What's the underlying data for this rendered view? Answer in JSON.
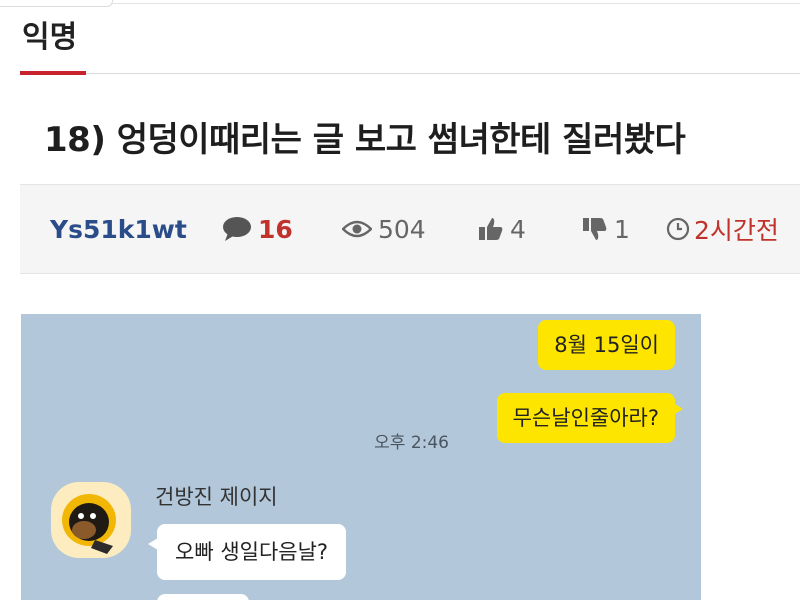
{
  "board": {
    "label": "익명"
  },
  "post": {
    "title": "18) 엉덩이때리는 글 보고 썸녀한테 질러봤다",
    "author": "Ys51k1wt",
    "comments": "16",
    "views": "504",
    "likes": "4",
    "dislikes": "1",
    "time": "2시간전"
  },
  "chat": {
    "messages_me": [
      "8월 15일이",
      "무슨날인줄아라?"
    ],
    "timestamp": "오후 2:46",
    "sender_name": "건방진 제이지",
    "reply": "오빠 생일다음날?"
  },
  "colors": {
    "accent_red": "#c8232c",
    "author_blue": "#2a4d8a",
    "chat_bg": "#b2c7d9",
    "my_bubble": "#fee500"
  },
  "icons": [
    "comment-icon",
    "eye-icon",
    "thumbs-up-icon",
    "thumbs-down-icon",
    "clock-icon"
  ]
}
